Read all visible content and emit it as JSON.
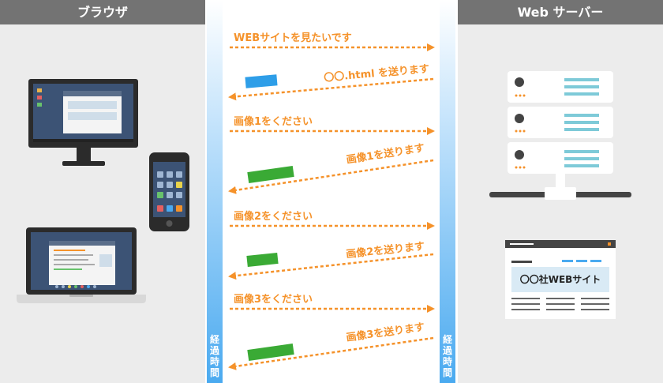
{
  "browser_panel": {
    "title": "ブラウザ"
  },
  "server_panel": {
    "title": "Web サーバー",
    "site_label": "〇〇社WEBサイト"
  },
  "timeline": {
    "label": "経過時間"
  },
  "messages": [
    {
      "text": "WEBサイトを見たいです",
      "direction": "request"
    },
    {
      "text": "〇〇.html を送ります",
      "direction": "response",
      "payload_color": "#2e9ee8"
    },
    {
      "text": "画像1をください",
      "direction": "request"
    },
    {
      "text": "画像1を送ります",
      "direction": "response",
      "payload_color": "#3aaa35"
    },
    {
      "text": "画像2をください",
      "direction": "request"
    },
    {
      "text": "画像2を送ります",
      "direction": "response",
      "payload_color": "#3aaa35"
    },
    {
      "text": "画像3をください",
      "direction": "request"
    },
    {
      "text": "画像3を送ります",
      "direction": "response",
      "payload_color": "#3aaa35"
    }
  ],
  "colors": {
    "arrow": "#f5922a",
    "panel_bg": "#ececec",
    "panel_head": "#737373",
    "timeline": "#4aaaf0",
    "server_accent": "#7ecad8"
  }
}
